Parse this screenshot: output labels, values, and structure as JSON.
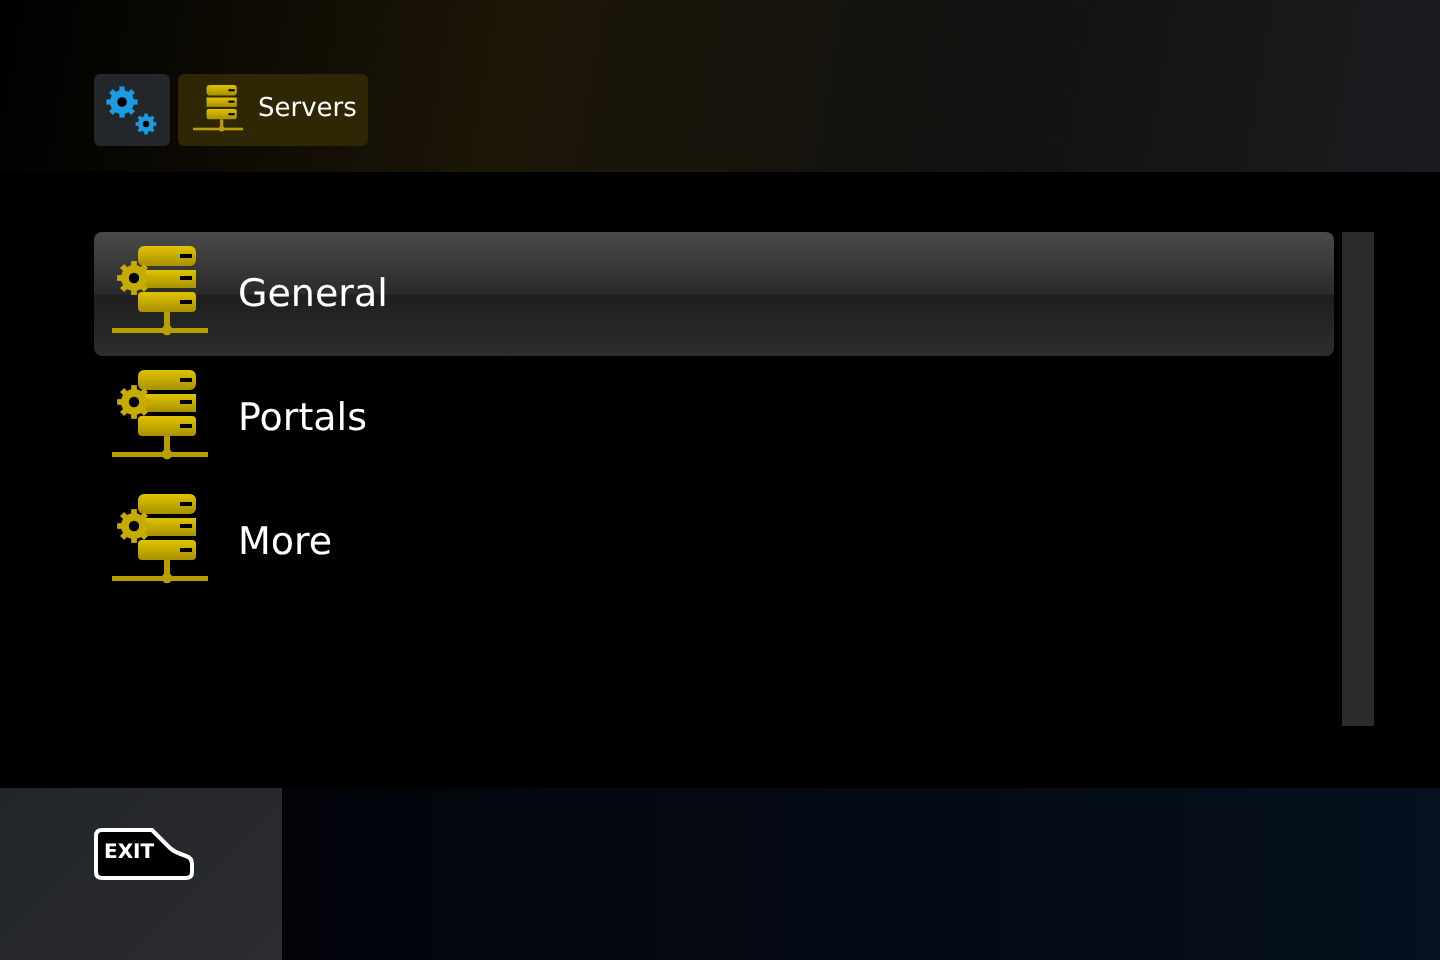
{
  "breadcrumb": [
    {
      "kind": "settings"
    },
    {
      "kind": "servers",
      "label": "Servers"
    }
  ],
  "menu": [
    {
      "label": "General",
      "selected": true
    },
    {
      "label": "Portals",
      "selected": false
    },
    {
      "label": "More",
      "selected": false
    }
  ],
  "footer": {
    "exit_key": "EXIT"
  }
}
